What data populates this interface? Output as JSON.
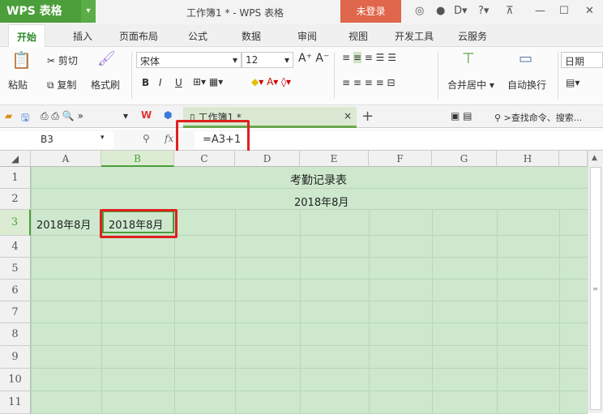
{
  "app": {
    "logo": "WPS 表格",
    "window_title": "工作簿1 * - WPS 表格",
    "login": "未登录"
  },
  "tabs": [
    "开始",
    "插入",
    "页面布局",
    "公式",
    "数据",
    "审阅",
    "视图",
    "开发工具",
    "云服务"
  ],
  "ribbon": {
    "paste": "粘贴",
    "cut": "剪切",
    "copy": "复制",
    "format_painter": "格式刷",
    "font": "宋体",
    "size": "12",
    "bold": "B",
    "italic": "I",
    "underline": "U",
    "merge": "合并居中",
    "wrap": "自动换行",
    "number_format": "日期"
  },
  "doc_tab": {
    "name": "工作簿1 *",
    "close": "×",
    "add": "+"
  },
  "search": "查找命令、搜索...",
  "formula_bar": {
    "name_box": "B3",
    "fx": "fx",
    "formula": "=A3+1"
  },
  "columns": [
    "A",
    "B",
    "C",
    "D",
    "E",
    "F",
    "G",
    "H"
  ],
  "rows": [
    "1",
    "2",
    "3",
    "4",
    "5",
    "6",
    "7",
    "8",
    "9",
    "10",
    "11"
  ],
  "cells": {
    "title": "考勤记录表",
    "month": "2018年8月",
    "A3": "2018年8月",
    "B3": "2018年8月"
  },
  "colors": {
    "accent": "#4b9e3a",
    "login": "#e0664c",
    "grid": "#cde8cd",
    "highlight": "#e02020"
  }
}
